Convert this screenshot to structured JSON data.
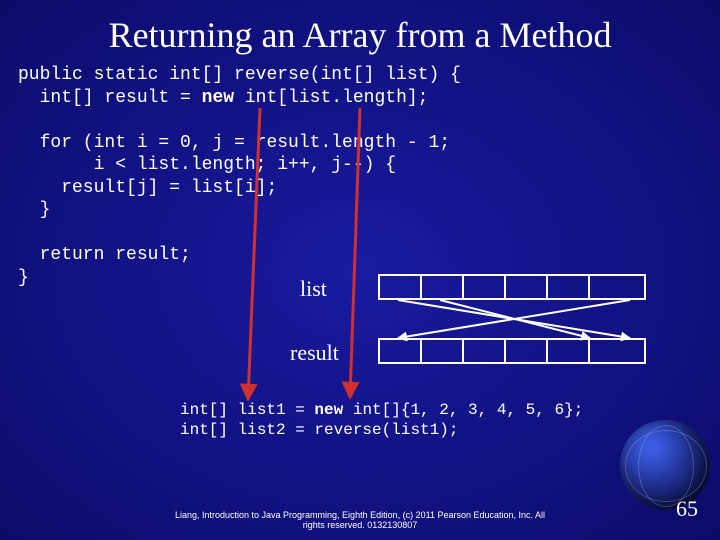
{
  "title": "Returning an Array from a Method",
  "code": {
    "l1a": "public static int[] reverse(int[] list) {",
    "l2a": "  int[] result = ",
    "l2b": "new",
    "l2c": " int[list.length];",
    "blank1": "",
    "l3": "  for (int i = 0, j = result.length - 1;",
    "l4": "       i < list.length; i++, j--) {",
    "l5": "    result[j] = list[i];",
    "l6": "  }",
    "blank2": "",
    "l7": "  return result;",
    "l8": "}"
  },
  "labels": {
    "list": "list",
    "result": "result"
  },
  "subcode": {
    "s1a": "int[] list1 = ",
    "s1b": "new",
    "s1c": " int[]{1, 2, 3, 4, 5, 6};",
    "s2": "int[] list2 = reverse(list1);"
  },
  "footer": {
    "l1": "Liang, Introduction to Java Programming, Eighth Edition, (c) 2011 Pearson Education, Inc. All",
    "l2": "rights reserved. 0132130807"
  },
  "pagenum": "65",
  "chart_data": {
    "type": "table",
    "note": "Two 6-cell array illustrations (list and result); cells are empty in the slide."
  }
}
